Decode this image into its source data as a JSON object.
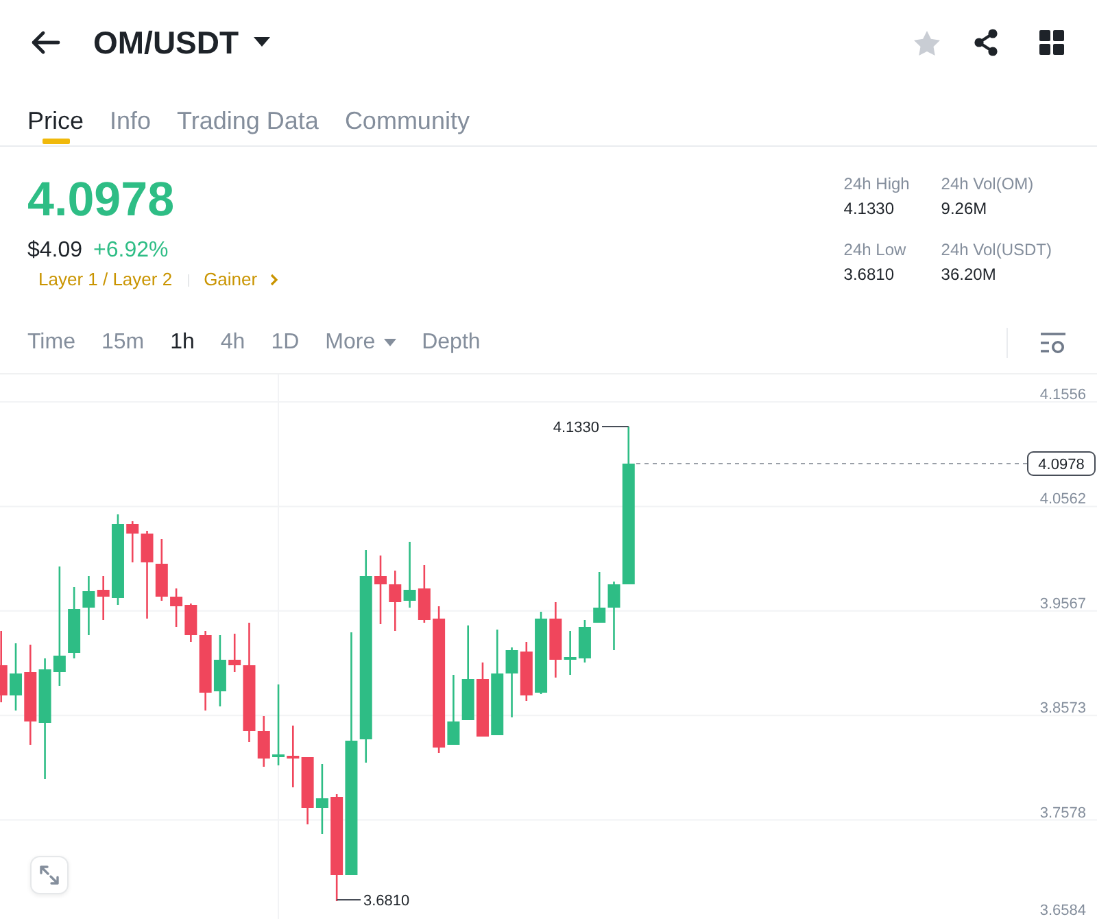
{
  "header": {
    "pair": "OM/USDT",
    "favorited": false
  },
  "tabs": [
    {
      "label": "Price",
      "selected": true
    },
    {
      "label": "Info",
      "selected": false
    },
    {
      "label": "Trading Data",
      "selected": false
    },
    {
      "label": "Community",
      "selected": false
    }
  ],
  "ticker": {
    "last_price": "4.0978",
    "fiat_price": "$4.09",
    "change": "+6.92%",
    "tags": [
      {
        "label": "Layer 1 / Layer 2",
        "kind": "category"
      },
      {
        "label": "Gainer",
        "kind": "link"
      }
    ],
    "stats": [
      {
        "label": "24h High",
        "value": "4.1330"
      },
      {
        "label": "24h Vol(OM)",
        "value": "9.26M"
      },
      {
        "label": "24h Low",
        "value": "3.6810"
      },
      {
        "label": "24h Vol(USDT)",
        "value": "36.20M"
      }
    ]
  },
  "intervals": [
    {
      "label": "Time",
      "selected": false,
      "kind": "option"
    },
    {
      "label": "15m",
      "selected": false,
      "kind": "option"
    },
    {
      "label": "1h",
      "selected": true,
      "kind": "option"
    },
    {
      "label": "4h",
      "selected": false,
      "kind": "option"
    },
    {
      "label": "1D",
      "selected": false,
      "kind": "option"
    },
    {
      "label": "More",
      "selected": false,
      "kind": "dropdown"
    },
    {
      "label": "Depth",
      "selected": false,
      "kind": "option"
    }
  ],
  "chart": {
    "price_axis": [
      "4.1556",
      "4.0562",
      "3.9567",
      "3.8573",
      "3.7578",
      "3.6584"
    ],
    "high_marker": "4.1330",
    "low_marker": "3.6810",
    "last_price_tag": "4.0978"
  }
}
